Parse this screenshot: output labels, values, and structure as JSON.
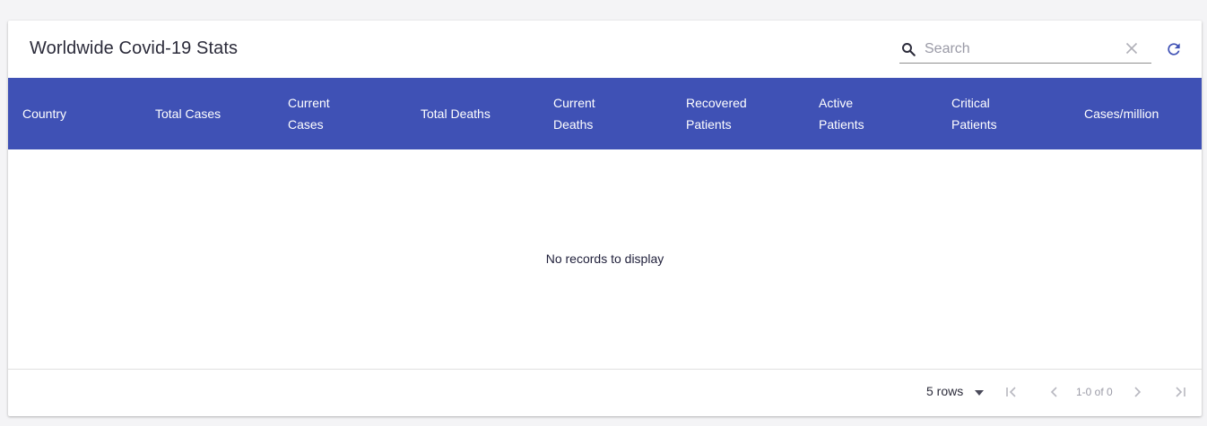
{
  "table": {
    "title": "Worldwide Covid-19 Stats",
    "search_placeholder": "Search",
    "columns": [
      {
        "line1": "Country",
        "line2": ""
      },
      {
        "line1": "Total Cases",
        "line2": ""
      },
      {
        "line1": "Current",
        "line2": "Cases"
      },
      {
        "line1": "Total Deaths",
        "line2": ""
      },
      {
        "line1": "Current",
        "line2": "Deaths"
      },
      {
        "line1": "Recovered",
        "line2": "Patients"
      },
      {
        "line1": "Active",
        "line2": "Patients"
      },
      {
        "line1": "Critical",
        "line2": "Patients"
      },
      {
        "line1": "Cases/million",
        "line2": ""
      }
    ],
    "empty_message": "No records to display",
    "header_color": "#3f51b5"
  },
  "pagination": {
    "rows_label": "5 rows",
    "page_info": "1-0 of 0"
  },
  "icons": {
    "search": "search-icon",
    "clear": "close-icon",
    "refresh": "refresh-icon",
    "first": "first-page-icon",
    "prev": "chevron-left-icon",
    "next": "chevron-right-icon",
    "last": "last-page-icon",
    "dropdown": "caret-down-icon"
  }
}
